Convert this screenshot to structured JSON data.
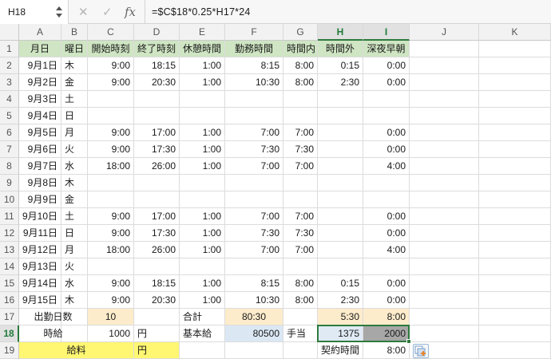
{
  "formula_bar": {
    "name_box": "H18",
    "cancel_icon": "✕",
    "enter_icon": "✓",
    "fx_label": "fx",
    "formula": "=$C$18*0.25*H17*24"
  },
  "columns": [
    "A",
    "B",
    "C",
    "D",
    "E",
    "F",
    "G",
    "H",
    "I",
    "J",
    "K"
  ],
  "rows": [
    "1",
    "2",
    "3",
    "4",
    "5",
    "6",
    "7",
    "8",
    "9",
    "10",
    "11",
    "12",
    "13",
    "14",
    "15",
    "16",
    "17",
    "18",
    "19"
  ],
  "header_row": [
    "月日",
    "曜日",
    "開始時刻",
    "終了時刻",
    "休憩時間",
    "勤務時間",
    "時間内",
    "時間外",
    "深夜早朝"
  ],
  "data_rows": [
    [
      "9月1日",
      "木",
      "9:00",
      "18:15",
      "1:00",
      "8:15",
      "8:00",
      "0:15",
      "0:00"
    ],
    [
      "9月2日",
      "金",
      "9:00",
      "20:30",
      "1:00",
      "10:30",
      "8:00",
      "2:30",
      "0:00"
    ],
    [
      "9月3日",
      "土",
      "",
      "",
      "",
      "",
      "",
      "",
      ""
    ],
    [
      "9月4日",
      "日",
      "",
      "",
      "",
      "",
      "",
      "",
      ""
    ],
    [
      "9月5日",
      "月",
      "9:00",
      "17:00",
      "1:00",
      "7:00",
      "7:00",
      "",
      "0:00"
    ],
    [
      "9月6日",
      "火",
      "9:00",
      "17:30",
      "1:00",
      "7:30",
      "7:30",
      "",
      "0:00"
    ],
    [
      "9月7日",
      "水",
      "18:00",
      "26:00",
      "1:00",
      "7:00",
      "7:00",
      "",
      "4:00"
    ],
    [
      "9月8日",
      "木",
      "",
      "",
      "",
      "",
      "",
      "",
      ""
    ],
    [
      "9月9日",
      "金",
      "",
      "",
      "",
      "",
      "",
      "",
      ""
    ],
    [
      "9月10日",
      "土",
      "9:00",
      "17:00",
      "1:00",
      "7:00",
      "7:00",
      "",
      "0:00"
    ],
    [
      "9月11日",
      "日",
      "9:00",
      "17:30",
      "1:00",
      "7:30",
      "7:30",
      "",
      "0:00"
    ],
    [
      "9月12日",
      "月",
      "18:00",
      "26:00",
      "1:00",
      "7:00",
      "7:00",
      "",
      "4:00"
    ],
    [
      "9月13日",
      "火",
      "",
      "",
      "",
      "",
      "",
      "",
      ""
    ],
    [
      "9月14日",
      "水",
      "9:00",
      "18:15",
      "1:00",
      "8:15",
      "8:00",
      "0:15",
      "0:00"
    ],
    [
      "9月15日",
      "木",
      "9:00",
      "20:30",
      "1:00",
      "10:30",
      "8:00",
      "2:30",
      "0:00"
    ]
  ],
  "summary": {
    "r17": {
      "label": "出勤日数",
      "days": "10",
      "total_label": "合計",
      "work_total": "80:30",
      "overtime_total": "5:30",
      "night_total": "8:00"
    },
    "r18": {
      "label": "時給",
      "wage": "1000",
      "yen": "円",
      "base_label": "基本給",
      "base_pay": "80500",
      "allowance_label": "手当",
      "overtime_pay": "1375",
      "night_pay": "2000"
    },
    "r19": {
      "label": "給料",
      "yen": "円",
      "contract_label": "契約時間",
      "contract_hours": "8:00"
    }
  },
  "colors": {
    "header_green": "#cfe5c3",
    "selection_green": "#2d7a3d",
    "orange_fill": "#fdeccb",
    "blue_fill": "#dbe8f4",
    "yellow_fill": "#fff772"
  }
}
